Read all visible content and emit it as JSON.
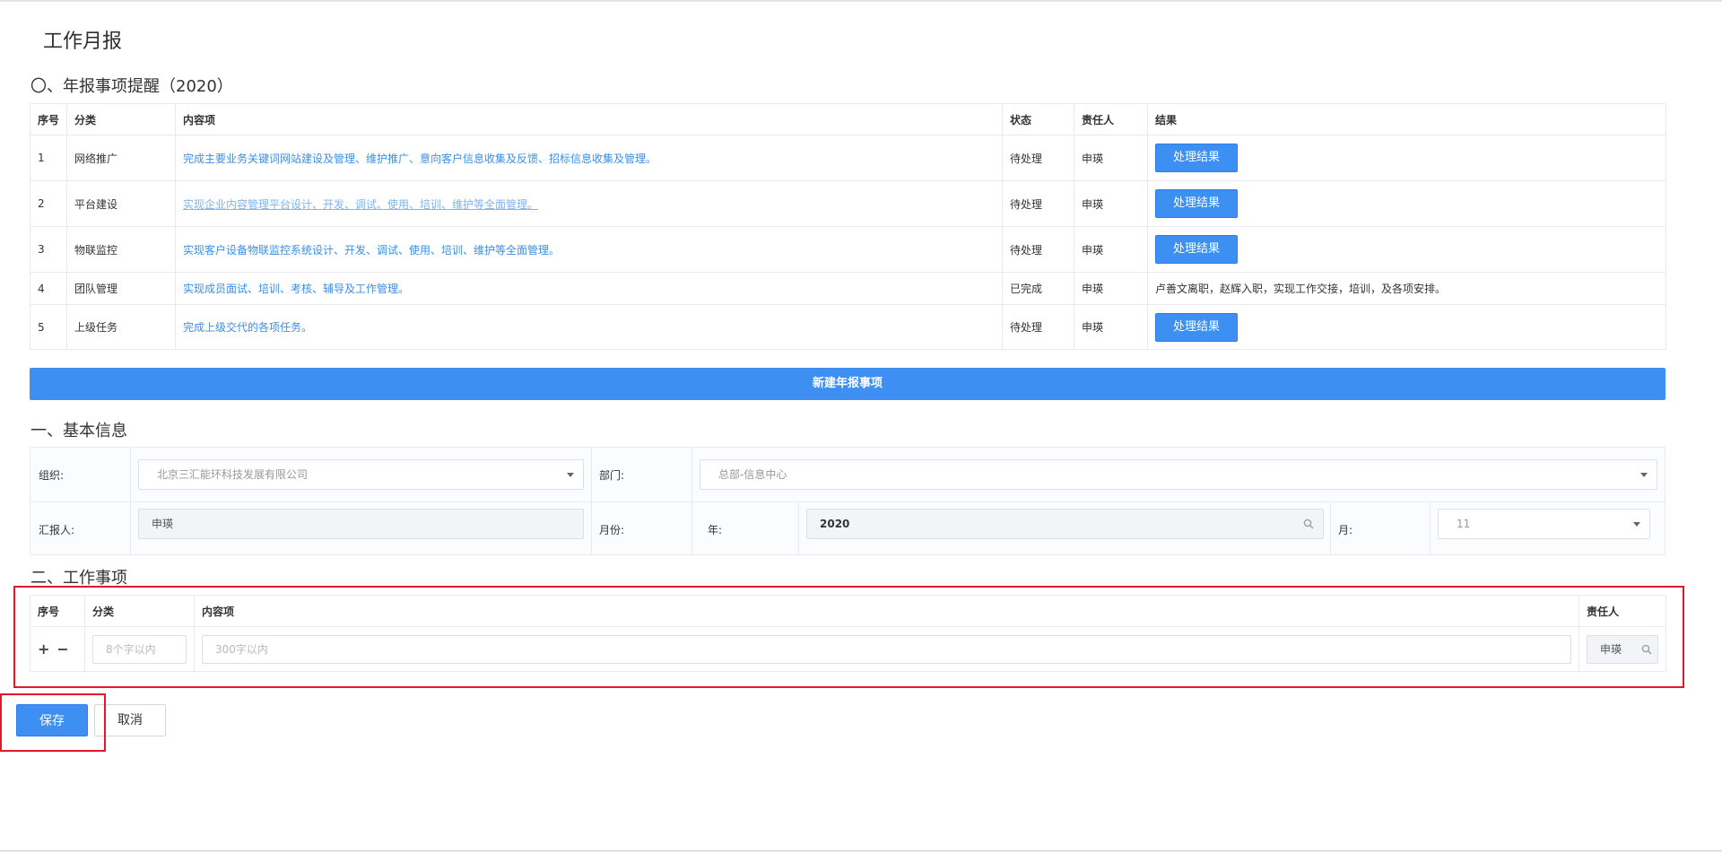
{
  "page_title": "工作月报",
  "reminder": {
    "section_title": "〇、年报事项提醒（2020）",
    "headers": [
      "序号",
      "分类",
      "内容项",
      "状态",
      "责任人",
      "结果"
    ],
    "rows": [
      {
        "no": "1",
        "category": "网络推广",
        "content": "完成主要业务关键词网站建设及管理、维护推广、意向客户信息收集及反馈、招标信息收集及管理。",
        "status": "待处理",
        "owner": "申瑛",
        "result": "处理结果"
      },
      {
        "no": "2",
        "category": "平台建设",
        "content": "实现企业内容管理平台设计、开发、调试、使用、培训、维护等全面管理。",
        "status": "待处理",
        "owner": "申瑛",
        "result": "处理结果"
      },
      {
        "no": "3",
        "category": "物联监控",
        "content": "实现客户设备物联监控系统设计、开发、调试、使用、培训、维护等全面管理。",
        "status": "待处理",
        "owner": "申瑛",
        "result": "处理结果"
      },
      {
        "no": "4",
        "category": "团队管理",
        "content": "实现成员面试、培训、考核、辅导及工作管理。",
        "status": "已完成",
        "owner": "申瑛",
        "result": "卢善文离职，赵辉入职，实现工作交接，培训，及各项安排。"
      },
      {
        "no": "5",
        "category": "上级任务",
        "content": "完成上级交代的各项任务。",
        "status": "待处理",
        "owner": "申瑛",
        "result": "处理结果"
      }
    ],
    "new_button": "新建年报事项"
  },
  "basic_info": {
    "section_title": "一、基本信息",
    "org_label": "组织:",
    "org_value": "北京三汇能环科技发展有限公司",
    "dept_label": "部门:",
    "dept_value": "总部-信息中心",
    "reporter_label": "汇报人:",
    "reporter_value": "申瑛",
    "month_label": "月份:",
    "year_label": "年:",
    "year_value": "2020",
    "mon_label": "月:",
    "mon_value": "11"
  },
  "work_items": {
    "section_title": "二、工作事项",
    "headers": [
      "序号",
      "分类",
      "内容项",
      "责任人"
    ],
    "category_placeholder": "8个字以内",
    "content_placeholder": "300字以内",
    "owner_value": "申瑛",
    "plus": "+",
    "minus": "−"
  },
  "actions": {
    "save": "保存",
    "cancel": "取消"
  },
  "colors": {
    "primary": "#3d8ff2",
    "link": "#3c8ee8",
    "highlight": "#e0192a"
  }
}
